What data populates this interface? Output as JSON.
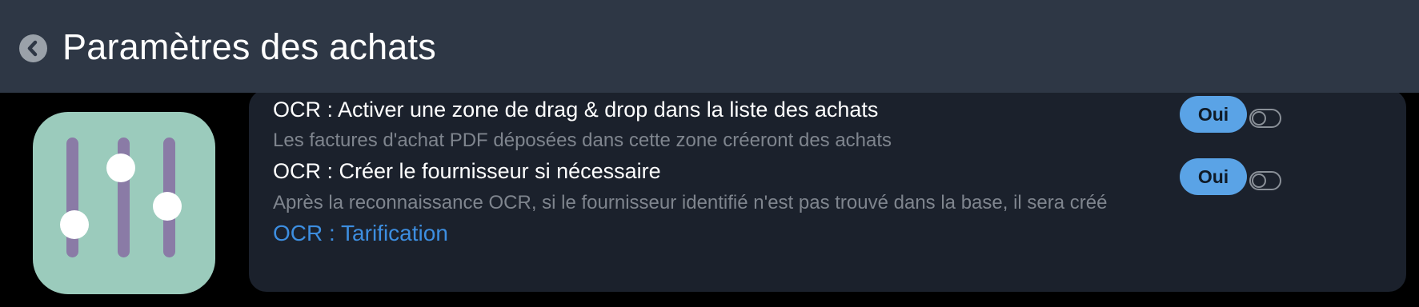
{
  "header": {
    "title": "Paramètres des achats",
    "back_icon": "chevron-left-icon"
  },
  "app_icon": {
    "icon": "sliders-icon",
    "background_color": "#9bcbbc",
    "track_color": "#8a7ba6"
  },
  "settings": [
    {
      "title": "OCR : Activer une zone de drag & drop dans la liste des achats",
      "description": "Les factures d'achat PDF déposées dans cette zone créeront des achats",
      "value_label": "Oui"
    },
    {
      "title": "OCR : Créer le fournisseur si nécessaire",
      "description": "Après la reconnaissance OCR, si le fournisseur identifié n'est pas trouvé dans la base, il sera créé",
      "value_label": "Oui"
    }
  ],
  "link": {
    "label": "OCR : Tarification"
  },
  "colors": {
    "header_bg": "#2e3745",
    "panel_bg": "#1b212c",
    "accent_button": "#5aa3e6",
    "link": "#3d8ee0"
  }
}
